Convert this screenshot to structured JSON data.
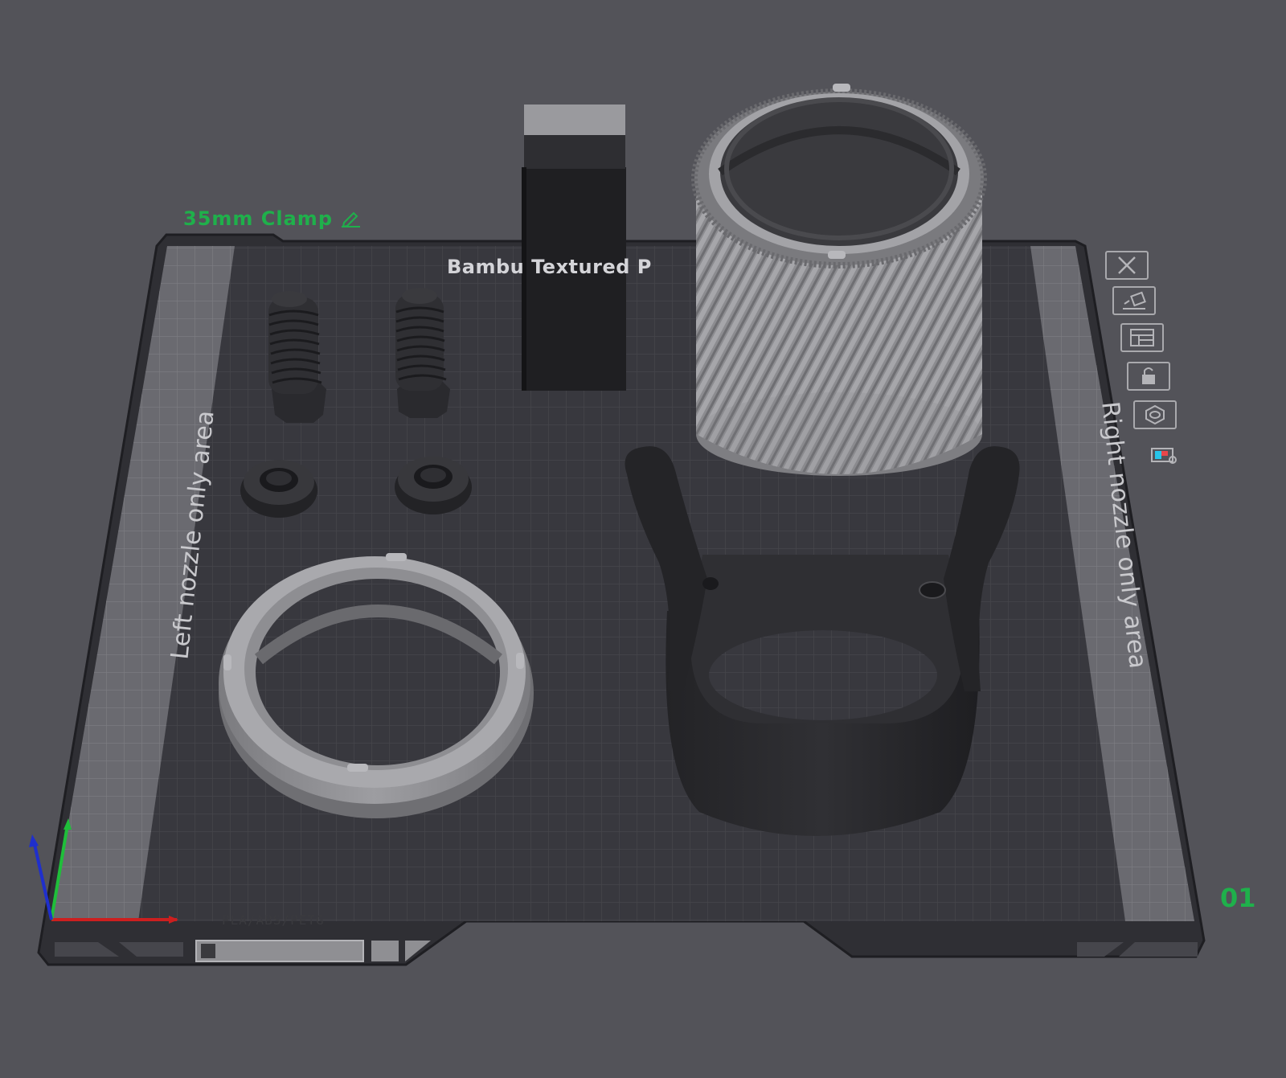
{
  "plate": {
    "name": "35mm Clamp",
    "number": "01",
    "title": "Bambu Textured P",
    "left_area_label": "Left nozzle only area",
    "right_area_label": "Right nozzle only area",
    "material_label": "PLA/ABS/PETG"
  },
  "plate_toolbar": [
    {
      "icon": "close-icon"
    },
    {
      "icon": "auto-orient-icon"
    },
    {
      "icon": "arrange-icon"
    },
    {
      "icon": "lock-icon"
    },
    {
      "icon": "plate-settings-icon"
    },
    {
      "icon": "filament-map-icon"
    }
  ],
  "colors": {
    "background": "#535359",
    "plate": "#34343a",
    "plate_grid": "#46464c",
    "exclusion_area": "#6d6d72",
    "accent_green": "#1fb04b",
    "part_light_gray": "#9a9a9e",
    "part_dark": "#2b2b2e",
    "axis_x": "#cc1f1f",
    "axis_y": "#1fbf3a",
    "axis_z": "#1f2fcc"
  }
}
